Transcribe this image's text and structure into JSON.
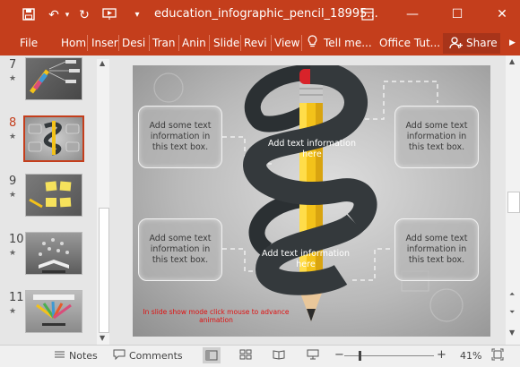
{
  "window": {
    "title": "education_infographic_pencil_18995...",
    "minimize": "—",
    "restore": "☐",
    "close": "✕"
  },
  "ribbon": {
    "tabs": [
      "File",
      "Hom",
      "Inser",
      "Desi",
      "Tran",
      "Anin",
      "Slide",
      "Revi",
      "View"
    ],
    "tell_me": "Tell me...",
    "office_tut": "Office Tut...",
    "share": "Share"
  },
  "thumbnails": [
    {
      "number": "7",
      "star": "★"
    },
    {
      "number": "8",
      "star": "★"
    },
    {
      "number": "9",
      "star": "★"
    },
    {
      "number": "10",
      "star": "★"
    },
    {
      "number": "11",
      "star": "★"
    }
  ],
  "slide": {
    "box_top_left": "Add some text information in this text box.",
    "box_top_right": "Add some text information in this text box.",
    "box_bottom_left": "Add some text information in this text box.",
    "box_bottom_right": "Add some text information in this text box.",
    "ribbon_text_top": "Add text information here",
    "ribbon_text_bottom": "Add text information here",
    "hint": "In slide show mode click mouse to advance animation"
  },
  "status": {
    "notes": "Notes",
    "comments": "Comments",
    "zoom_minus": "−",
    "zoom_plus": "+",
    "zoom": "41%",
    "zoom_level": 0.41
  },
  "colors": {
    "accent": "#c43e1c",
    "ribbon_band": "#34393c",
    "pencil": "#f3c21a"
  }
}
